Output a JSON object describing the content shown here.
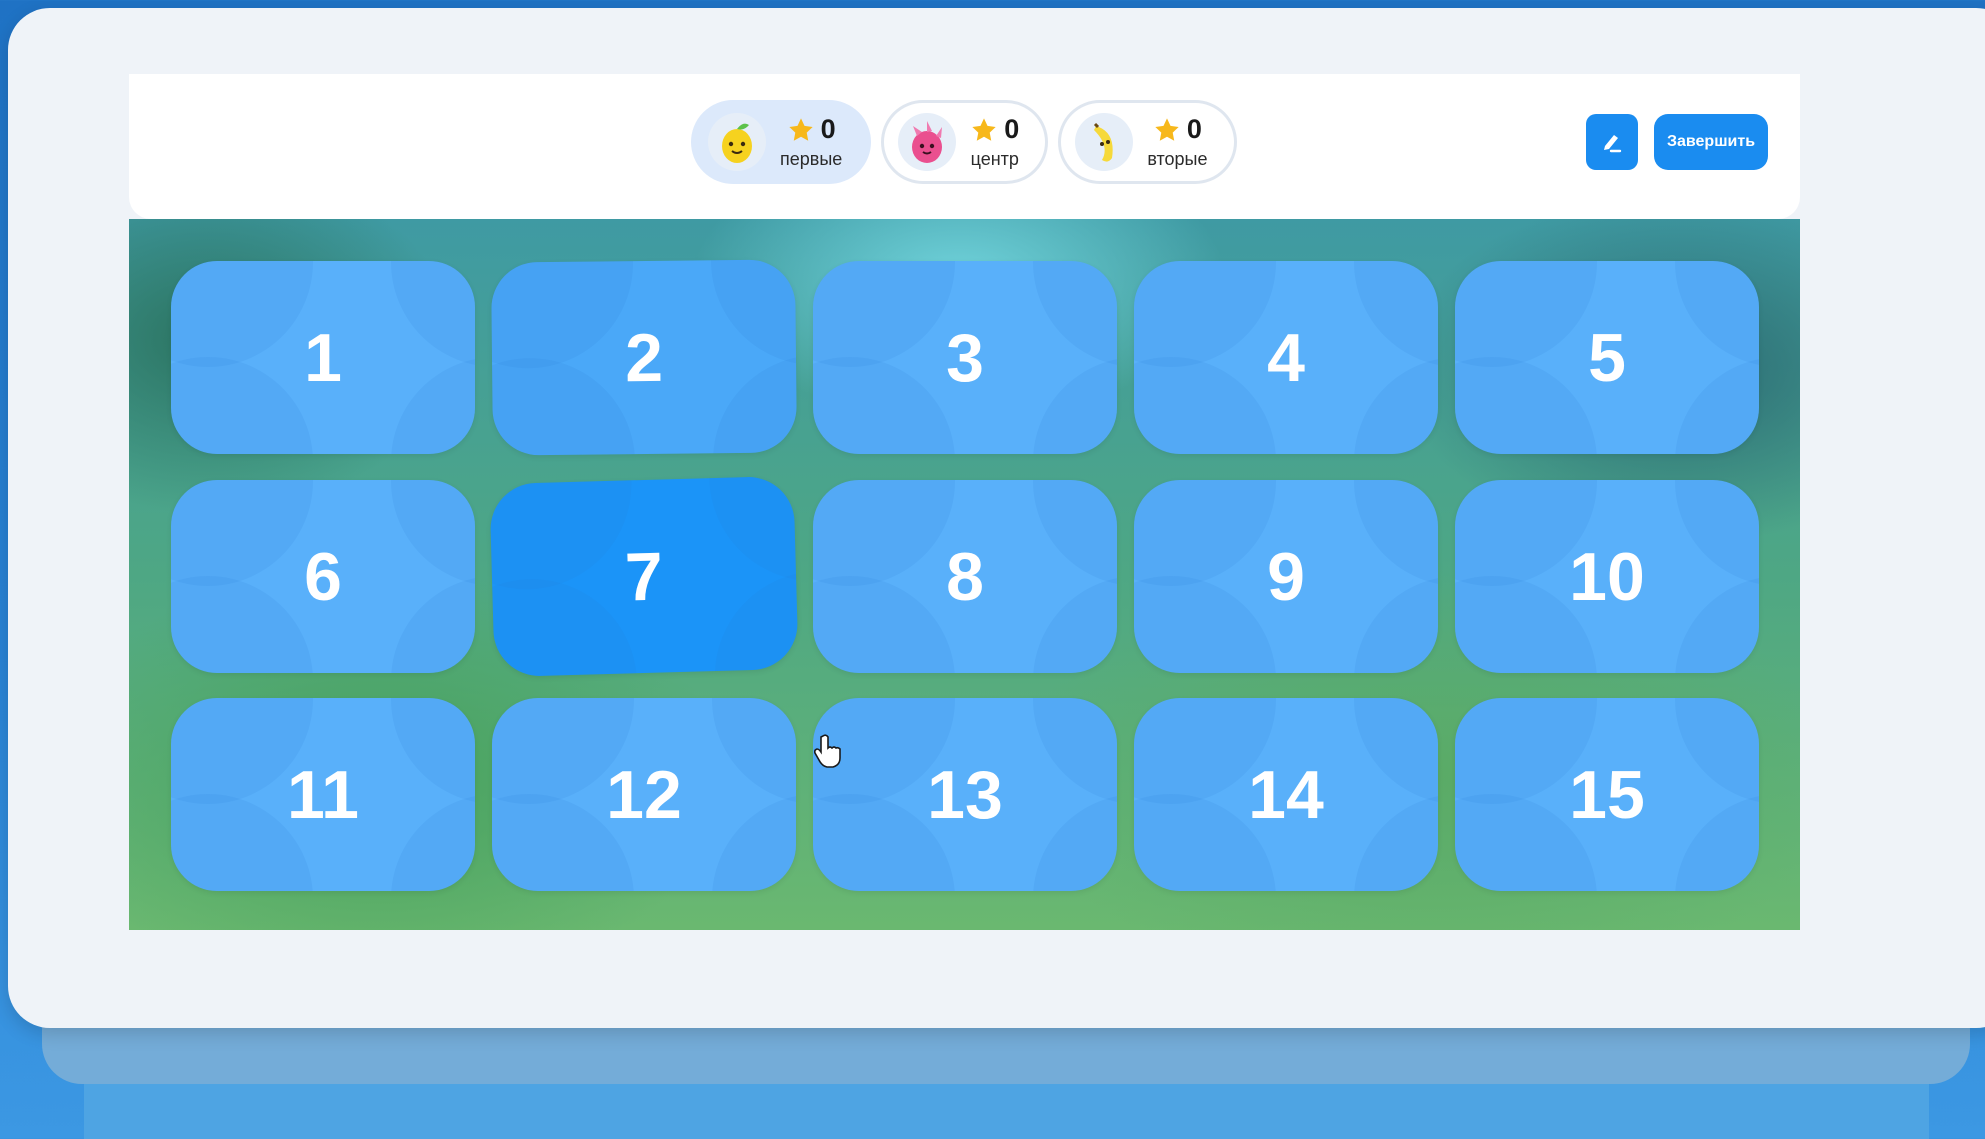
{
  "teams": [
    {
      "name": "первые",
      "score": "0",
      "avatar": "lemon-icon",
      "active": true
    },
    {
      "name": "центр",
      "score": "0",
      "avatar": "dragonfruit-icon",
      "active": false
    },
    {
      "name": "вторые",
      "score": "0",
      "avatar": "banana-icon",
      "active": false
    }
  ],
  "toolbar": {
    "edit_icon": "pen-icon",
    "finish_label": "Завершить"
  },
  "tiles": [
    "1",
    "2",
    "3",
    "4",
    "5",
    "6",
    "7",
    "8",
    "9",
    "10",
    "11",
    "12",
    "13",
    "14",
    "15"
  ],
  "selected_tile": "7",
  "colors": {
    "accent": "#1a8cf0",
    "tile": "#59b0fa",
    "tile_active": "#1b94f8"
  }
}
